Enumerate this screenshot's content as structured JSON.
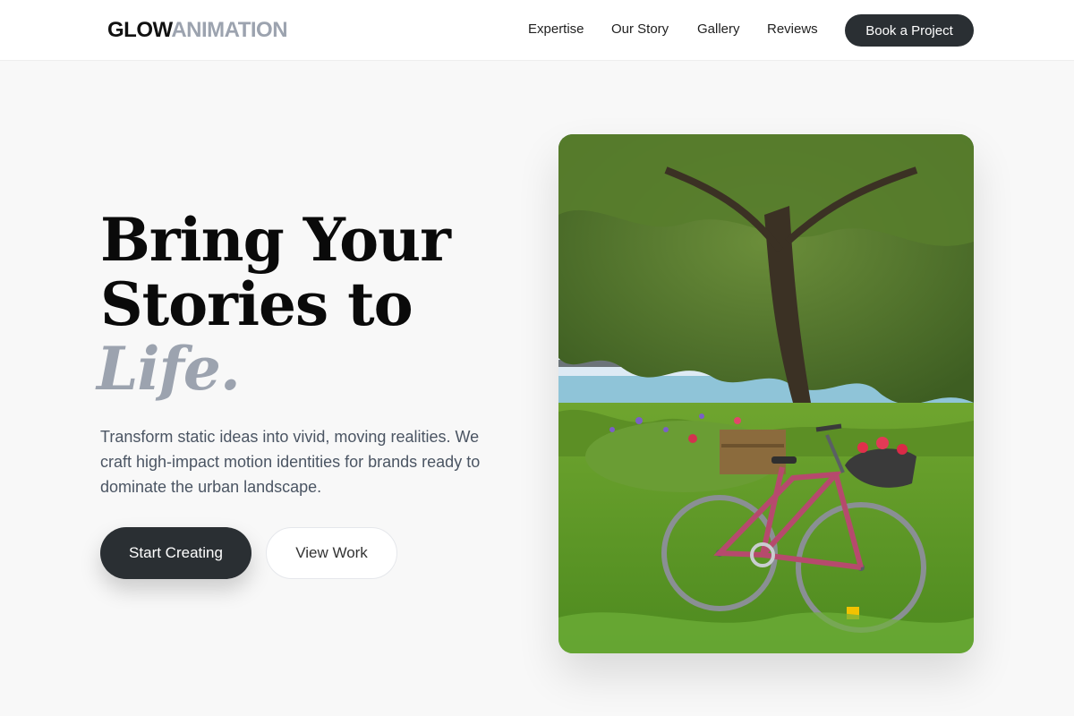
{
  "brand": {
    "part1": "GLOW",
    "part2": "ANIMATION"
  },
  "nav": {
    "links": [
      "Expertise",
      "Our Story",
      "Gallery",
      "Reviews"
    ],
    "cta": "Book a Project"
  },
  "hero": {
    "title_line1": "Bring Your",
    "title_line2": "Stories to",
    "title_accent": "Life.",
    "subtitle": "Transform static ideas into vivid, moving realities. We craft high-impact motion identities for brands ready to dominate the urban landscape.",
    "primary_button": "Start Creating",
    "secondary_button": "View Work"
  },
  "colors": {
    "primary_dark": "#2a2f33",
    "accent_gray": "#9ca3af",
    "background": "#f8f8f8"
  },
  "icons": {
    "hero_image": "bicycle-photo"
  }
}
